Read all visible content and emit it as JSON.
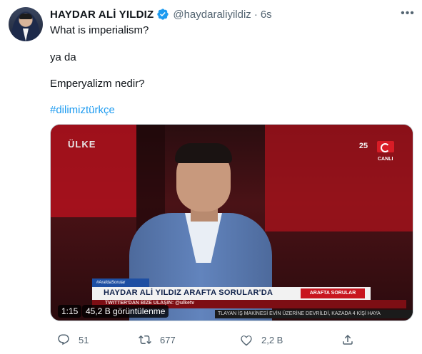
{
  "tweet": {
    "author_name": "HAYDAR ALİ YILDIZ",
    "handle": "@haydaraliyildiz",
    "separator": "·",
    "time": "6s",
    "more_label": "•••",
    "lines": [
      "What is imperialism?",
      "ya da",
      "Emperyalizm nedir?"
    ],
    "hashtag": "#dilimiztürkçe"
  },
  "video": {
    "duration": "1:15",
    "views": "45,2 B görüntülenme",
    "logo_text": "ÜLKE",
    "anniversary": "25",
    "live_label": "CANLI",
    "lower_third_small": "#ArafdaSorular",
    "lower_third_title": "HAYDAR ALİ YILDIZ ARAFTA SORULAR'DA",
    "lower_third_tag": "ARAFTA SORULAR",
    "lower_third_sub": "TWITTER'DAN BİZE ULAŞIN: @ulketv",
    "ticker": "TLAYAN İŞ MAKİNESİ EVİN ÜZERİNE DEVRİLDİ, KAZADA 4 KİŞİ HAYA"
  },
  "actions": {
    "reply_count": "51",
    "retweet_count": "677",
    "like_count": "2,2 B"
  },
  "colors": {
    "accent": "#1d9bf0",
    "muted": "#536471"
  }
}
